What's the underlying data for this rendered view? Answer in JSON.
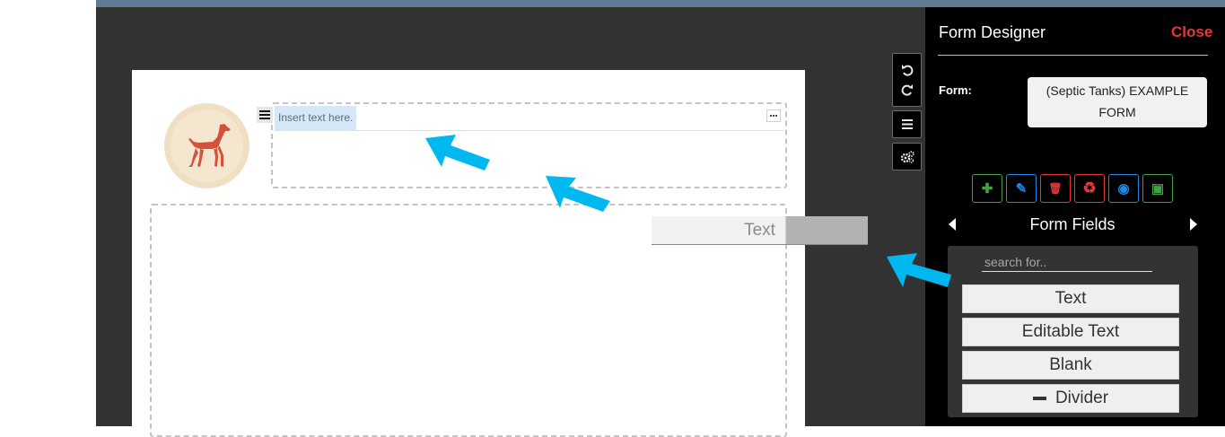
{
  "canvas": {
    "text_placeholder": "Insert text here.",
    "drag_ghost_label": "Text"
  },
  "toolbar": {
    "icons": [
      "undo-icon",
      "redo-icon",
      "menu-icon",
      "settings-cogs-icon"
    ]
  },
  "panel": {
    "title": "Form Designer",
    "close_label": "Close",
    "form_label": "Form:",
    "form_name": "(Septic Tanks) EXAMPLE FORM",
    "actions": [
      {
        "icon": "plus-icon",
        "glyph": "✚",
        "color": "#43a047"
      },
      {
        "icon": "pencil-icon",
        "glyph": "✎",
        "color": "#1e88e5"
      },
      {
        "icon": "trash-icon",
        "glyph": "🗑",
        "color": "#e53935"
      },
      {
        "icon": "recycle-icon",
        "glyph": "♻",
        "color": "#e53935"
      },
      {
        "icon": "eye-icon",
        "glyph": "◉",
        "color": "#1e88e5"
      },
      {
        "icon": "save-icon",
        "glyph": "▣",
        "color": "#43a047"
      }
    ],
    "fields_title": "Form Fields",
    "search_placeholder": "search for..",
    "fields": [
      "Text",
      "Editable Text",
      "Blank",
      "Divider"
    ]
  },
  "colors": {
    "accent_arrow": "#00b8f0",
    "close": "#e53935",
    "header_bar": "#5f7b96"
  }
}
